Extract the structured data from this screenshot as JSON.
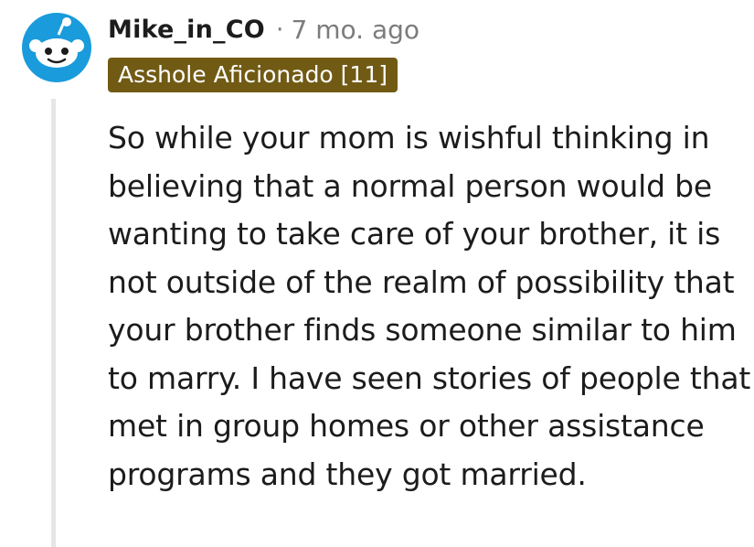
{
  "comment": {
    "author": "Mike_in_CO",
    "separator": "·",
    "timestamp": "7 mo. ago",
    "flair": "Asshole Aficionado [11]",
    "flair_color": "#715a14",
    "avatar_icon": "reddit-snoo-avatar-icon",
    "avatar_color": "#1a9bdb",
    "body": "So while your mom is wishful thinking in believing that a normal person would be wanting to take care of your brother, it is not outside of the realm of possibility that your brother finds someone similar to him to marry. I have seen stories of people that met in group homes or other assistance programs and they got married."
  }
}
